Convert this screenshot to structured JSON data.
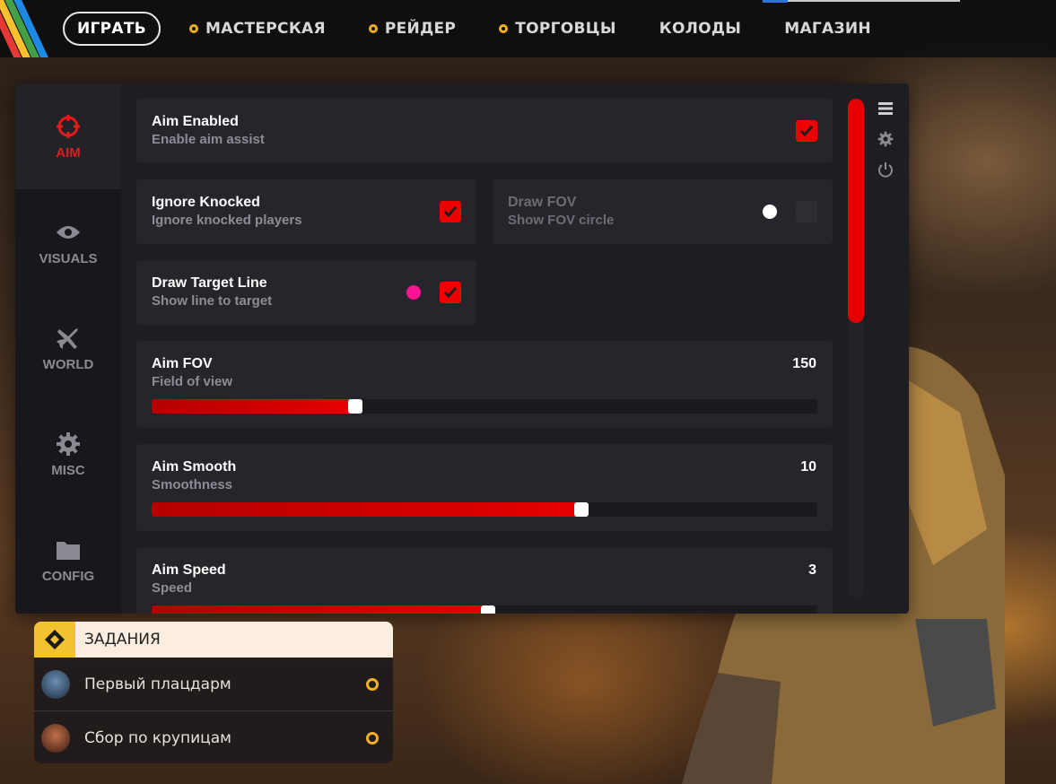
{
  "nav": {
    "play": "ИГРАТЬ",
    "items": [
      "МАСТЕРСКАЯ",
      "РЕЙДЕР",
      "ТОРГОВЦЫ",
      "КОЛОДЫ",
      "МАГАЗИН"
    ]
  },
  "sidebar": {
    "tabs": [
      {
        "label": "AIM",
        "icon": "crosshair-icon"
      },
      {
        "label": "VISUALS",
        "icon": "eye-icon"
      },
      {
        "label": "WORLD",
        "icon": "airplane-icon"
      },
      {
        "label": "MISC",
        "icon": "gear-icon"
      },
      {
        "label": "CONFIG",
        "icon": "folder-icon"
      }
    ]
  },
  "options": {
    "aim_enabled": {
      "title": "Aim Enabled",
      "subtitle": "Enable aim assist",
      "checked": true
    },
    "ignore_knocked": {
      "title": "Ignore Knocked",
      "subtitle": "Ignore knocked players",
      "checked": true
    },
    "draw_fov": {
      "title": "Draw FOV",
      "subtitle": "Show FOV circle",
      "checked": false,
      "color": "#ffffff"
    },
    "draw_target_line": {
      "title": "Draw Target Line",
      "subtitle": "Show line to target",
      "checked": true,
      "color": "#ff1493"
    }
  },
  "sliders": {
    "aim_fov": {
      "title": "Aim FOV",
      "subtitle": "Field of view",
      "value": "150",
      "fraction": 0.3
    },
    "aim_smooth": {
      "title": "Aim Smooth",
      "subtitle": "Smoothness",
      "value": "10",
      "fraction": 0.64
    },
    "aim_speed": {
      "title": "Aim Speed",
      "subtitle": "Speed",
      "value": "3",
      "fraction": 0.5
    }
  },
  "rail_icons": [
    "menu-icon",
    "gear-icon",
    "power-icon"
  ],
  "quests": {
    "title": "ЗАДАНИЯ",
    "items": [
      "Первый плацдарм",
      "Сбор по крупицам"
    ]
  },
  "colors": {
    "accent": "#e00000",
    "quest_marker": "#f0b021"
  }
}
